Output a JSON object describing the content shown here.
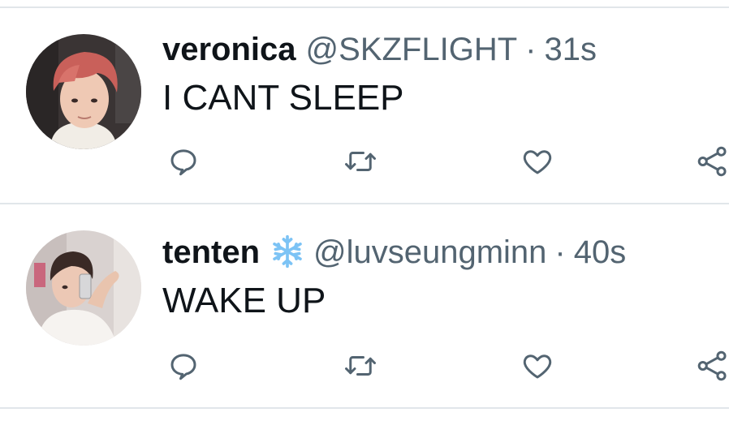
{
  "tweets": [
    {
      "display_name": "veronica",
      "handle": "@SKZFLIGHT",
      "separator": "·",
      "time": "31s",
      "text": "I CANT SLEEP",
      "emoji": "",
      "avatar": "avatar-photo-red-hair"
    },
    {
      "display_name": "tenten",
      "handle": "@luvseungminn",
      "separator": "·",
      "time": "40s",
      "text": "WAKE UP",
      "emoji": "snowflake-icon",
      "avatar": "avatar-photo-mirror-selfie"
    }
  ],
  "actions": [
    "reply-icon",
    "retweet-icon",
    "like-icon",
    "share-icon"
  ],
  "colors": {
    "text_primary": "#0f1419",
    "text_secondary": "#536471",
    "divider": "#e1e6ea",
    "snowflake": "#7cc3f5"
  }
}
